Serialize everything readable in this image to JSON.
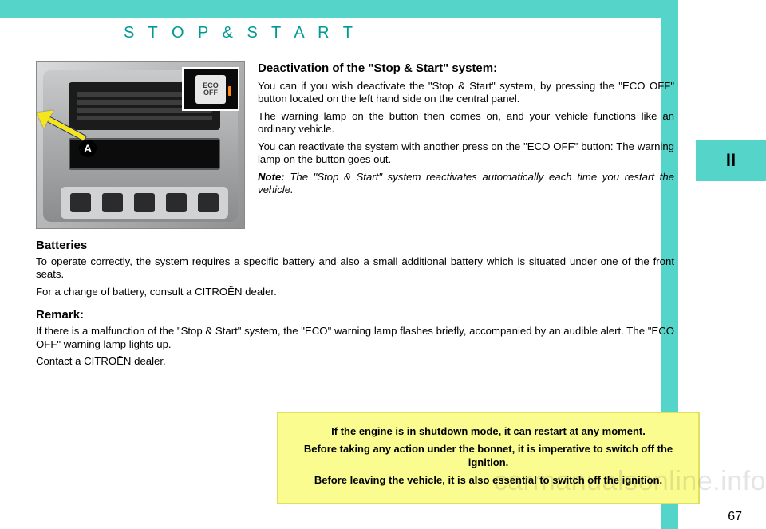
{
  "title": "S T O P   &   S T A R T",
  "section_tab": "II",
  "callout_letter": "A",
  "eco_button": {
    "line1": "ECO",
    "line2": "OFF"
  },
  "deactivation": {
    "heading": "Deactivation of the \"Stop & Start\" system:",
    "p1": "You can if you wish deactivate the \"Stop & Start\" system, by pressing the \"ECO OFF\" button located on the left hand side on the central panel.",
    "p2": "The warning lamp on the button then comes on, and your vehicle functions like an ordinary vehicle.",
    "p3": "You can reactivate the system with another press on the \"ECO OFF\" button: The warning lamp on the button goes out.",
    "note_label": "Note:",
    "note_text": " The \"Stop & Start\" system reactivates automatically each time you restart the vehicle."
  },
  "batteries": {
    "heading": "Batteries",
    "p1": "To operate correctly, the system requires a specific battery and also a small additional battery which is situated under one of the front seats.",
    "p2": "For a change of battery, consult a CITROËN dealer."
  },
  "remark": {
    "heading": "Remark:",
    "p1": "If there is a malfunction of the \"Stop & Start\" system, the \"ECO\" warning lamp flashes briefly, accompanied by an audible alert. The \"ECO OFF\" warning lamp lights up.",
    "p2": "Contact a CITROËN dealer."
  },
  "warning": {
    "l1": "If the engine is in shutdown mode, it can restart at any moment.",
    "l2": "Before taking any action under the bonnet, it is imperative to switch off the ignition.",
    "l3": "Before leaving the vehicle, it is also essential to switch off the ignition."
  },
  "page_number": "67",
  "watermark": "carmanualsonline.info"
}
